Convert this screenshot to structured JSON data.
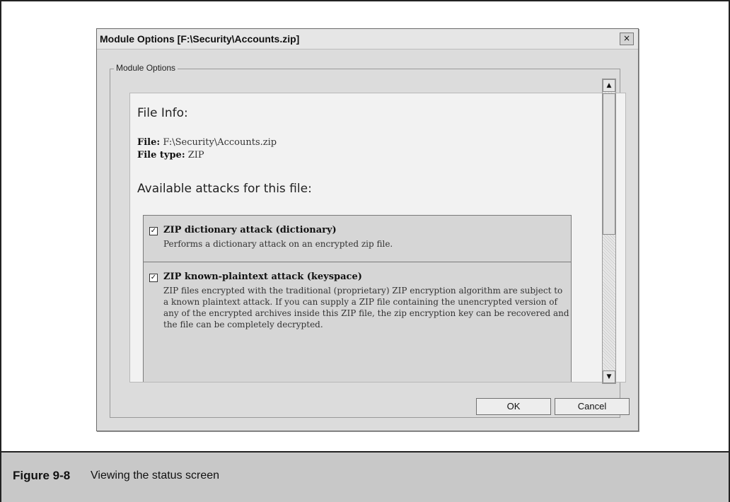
{
  "dialog": {
    "title": "Module Options [F:\\Security\\Accounts.zip]",
    "close_glyph": "×",
    "groupbox_label": "Module Options"
  },
  "file_info": {
    "heading": "File Info:",
    "file_label": "File:",
    "file_value": "F:\\Security\\Accounts.zip",
    "type_label": "File type:",
    "type_value": "ZIP"
  },
  "attacks": {
    "heading": "Available attacks for this file:",
    "items": [
      {
        "checked": true,
        "title": "ZIP dictionary attack (dictionary)",
        "description": "Performs a dictionary attack on an encrypted zip file."
      },
      {
        "checked": true,
        "title": "ZIP known-plaintext attack (keyspace)",
        "description": "ZIP files encrypted with the traditional (proprietary) ZIP encryption algorithm are subject to a known plaintext attack. If you can supply a ZIP file containing the unencrypted version of any of the encrypted archives inside this ZIP file, the zip encryption key can be recovered and the file can be completely decrypted."
      }
    ]
  },
  "scrollbar": {
    "up_icon": "up-arrow-icon",
    "down_icon": "down-arrow-icon"
  },
  "buttons": {
    "ok": "OK",
    "cancel": "Cancel"
  },
  "caption": {
    "number": "Figure 9-8",
    "text": "Viewing the status screen"
  }
}
